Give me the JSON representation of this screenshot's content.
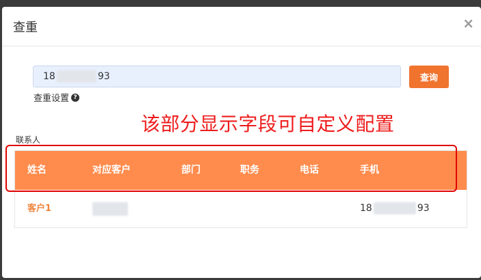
{
  "modal": {
    "title": "查重",
    "close_label": "×"
  },
  "search": {
    "value_prefix": "18",
    "value_suffix": "93",
    "button_label": "查询"
  },
  "settings": {
    "label": "查重设置",
    "help_icon": "?"
  },
  "annotation": {
    "text": "该部分显示字段可自定义配置",
    "color": "#ee1c1c"
  },
  "contacts": {
    "section_label": "联系人",
    "columns": [
      "姓名",
      "对应客户",
      "部门",
      "职务",
      "电话",
      "手机"
    ],
    "rows": [
      {
        "name": "客户1",
        "customer": "",
        "department": "",
        "position": "",
        "phone": "",
        "mobile_prefix": "18",
        "mobile_suffix": "93"
      }
    ]
  },
  "colors": {
    "accent": "#f0732e",
    "header_bg": "#ff8c4d",
    "link": "#f0843c"
  }
}
